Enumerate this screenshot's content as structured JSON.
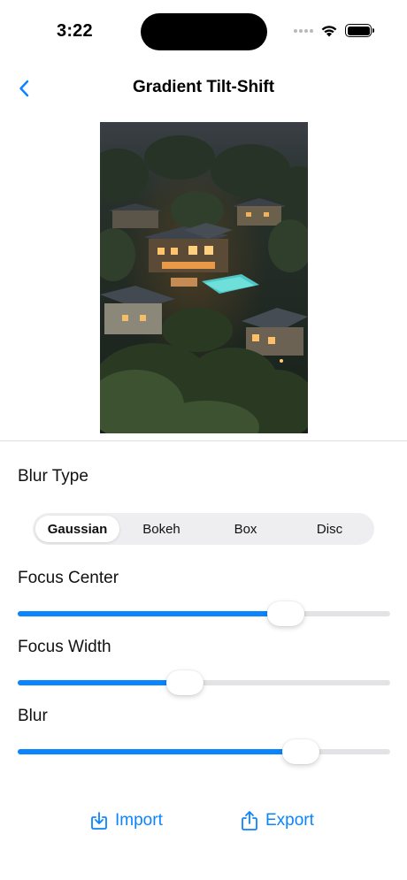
{
  "status_bar": {
    "time": "3:22"
  },
  "nav": {
    "back_icon": "chevron-left-icon",
    "title": "Gradient Tilt-Shift"
  },
  "photo": {
    "description_icon": "photo-image"
  },
  "blur_type": {
    "label": "Blur Type",
    "options": [
      "Gaussian",
      "Bokeh",
      "Box",
      "Disc"
    ],
    "selected": "Gaussian"
  },
  "focus_center": {
    "label": "Focus Center",
    "value": 0.72
  },
  "focus_width": {
    "label": "Focus Width",
    "value": 0.45
  },
  "blur": {
    "label": "Blur",
    "value": 0.76
  },
  "actions": {
    "import_label": "Import",
    "import_icon": "import-tray-icon",
    "export_label": "Export",
    "export_icon": "share-icon"
  },
  "colors": {
    "accent": "#0a84ff",
    "track": "#e3e3e6"
  }
}
